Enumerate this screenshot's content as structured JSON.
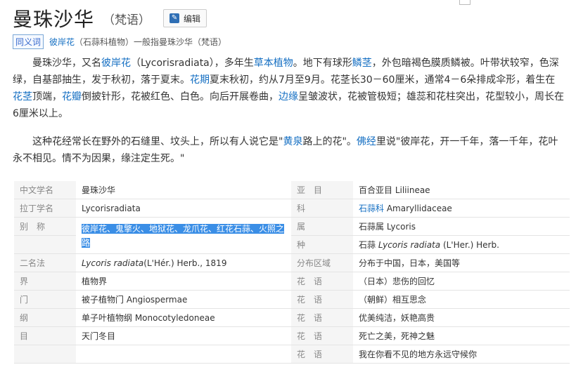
{
  "header": {
    "title": "曼珠沙华",
    "subtitle": "（梵语）",
    "edit_label": "编辑"
  },
  "synonym": {
    "tag": "同义词",
    "link": "彼岸花",
    "rest": "（石蒜科植物）一般指曼珠沙华（梵语）"
  },
  "paragraph1": {
    "t1": "曼珠沙华，又名",
    "l1": "彼岸花",
    "t2": "（Lycorisradiata），多年生",
    "l2": "草本植物",
    "t3": "。地下有球形",
    "l3": "鳞茎",
    "t4": "，外包暗褐色膜质鳞被。叶带状较窄，色深绿，自基部抽生，发于秋初，落于夏末。",
    "l4": "花期",
    "t5": "夏末秋初，约从7月至9月。花茎长30－60厘米，通常4－6朵排成伞形，着生在",
    "l5": "花茎",
    "t6": "顶端，",
    "l6": "花瓣",
    "t7": "倒披针形，花被红色、白色。向后开展卷曲，",
    "l7": "边缘",
    "t8": "呈皱波状，花被管极短；雄蕊和花柱突出，花型较小，周长在6厘米以上。"
  },
  "paragraph2": {
    "t1": "这种花经常长在野外的石缝里、坟头上，所以有人说它是\"",
    "l1": "黄泉",
    "t2": "路上的花\"。",
    "l2": "佛经",
    "t3": "里说\"彼岸花，开一千年，落一千年，花叶永不相见。情不为因果，缘注定生死。\""
  },
  "info": {
    "rows": [
      {
        "k": "中文学名",
        "v": "曼珠沙华",
        "k2": "亚　目",
        "v2": "百合亚目 Liliineae"
      },
      {
        "k": "拉丁学名",
        "v": "Lycorisradiata",
        "k2": "科",
        "v2_link": "石蒜科",
        "v2_rest": " Amaryllidaceae"
      },
      {
        "k": "别　称",
        "v": "彼岸花、鬼擎火、地狱花、龙爪花、红花石蒜、火照之路",
        "k2": "属",
        "v2": "石蒜属 Lycoris"
      },
      {
        "k": "",
        "v": "",
        "k2": "种",
        "v2_plain": "石蒜 ",
        "v2_italic": "Lycoris radiata",
        "v2_tail": " (L'Her.) Herb."
      },
      {
        "k": "二名法",
        "v_italic": "Lycoris radiata",
        "v_tail": "(L'Hér.) Herb., 1819",
        "k2": "分布区域",
        "v2": "分布于中国，日本，美国等"
      },
      {
        "k": "界",
        "v": "植物界",
        "k2": "花　语",
        "v2": "（日本）悲伤的回忆"
      },
      {
        "k": "门",
        "v": "被子植物门 Angiospermae",
        "k2": "花　语",
        "v2": "（朝鲜）相互思念"
      },
      {
        "k": "纲",
        "v": "单子叶植物纲 Monocotyledoneae",
        "k2": "花　语",
        "v2": "优美纯洁，妖艳高贵"
      },
      {
        "k": "目",
        "v": "天门冬目",
        "k2": "花　语",
        "v2": "死亡之美，死神之魅"
      },
      {
        "k": "",
        "v": "",
        "k2": "花　语",
        "v2": "我在你看不见的地方永远守候你"
      }
    ]
  }
}
